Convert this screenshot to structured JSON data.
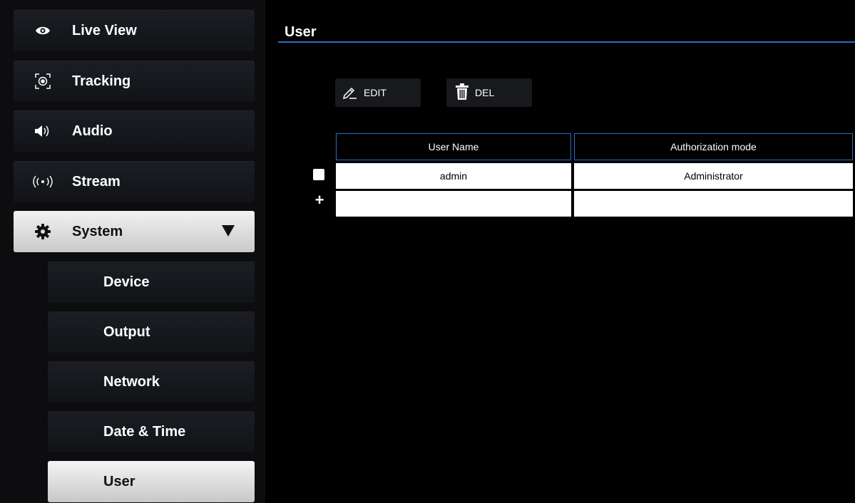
{
  "sidebar": {
    "items": [
      {
        "label": "Live View",
        "icon": "eye-icon"
      },
      {
        "label": "Tracking",
        "icon": "tracking-target-icon"
      },
      {
        "label": "Audio",
        "icon": "speaker-icon"
      },
      {
        "label": "Stream",
        "icon": "broadcast-icon"
      },
      {
        "label": "System",
        "icon": "gear-icon",
        "expanded": true
      }
    ],
    "subitems": [
      {
        "label": "Device"
      },
      {
        "label": "Output"
      },
      {
        "label": "Network"
      },
      {
        "label": "Date & Time"
      },
      {
        "label": "User",
        "selected": true
      }
    ]
  },
  "main": {
    "title": "User",
    "toolbar": {
      "edit_label": "EDIT",
      "delete_label": "DEL"
    },
    "table": {
      "headers": [
        "User Name",
        "Authorization mode"
      ],
      "rows": [
        [
          "admin",
          "Administrator"
        ]
      ],
      "add_symbol": "+"
    }
  },
  "colors": {
    "accent": "#2b6cc4",
    "background": "#000000",
    "active_item": "#dcdcdc"
  }
}
